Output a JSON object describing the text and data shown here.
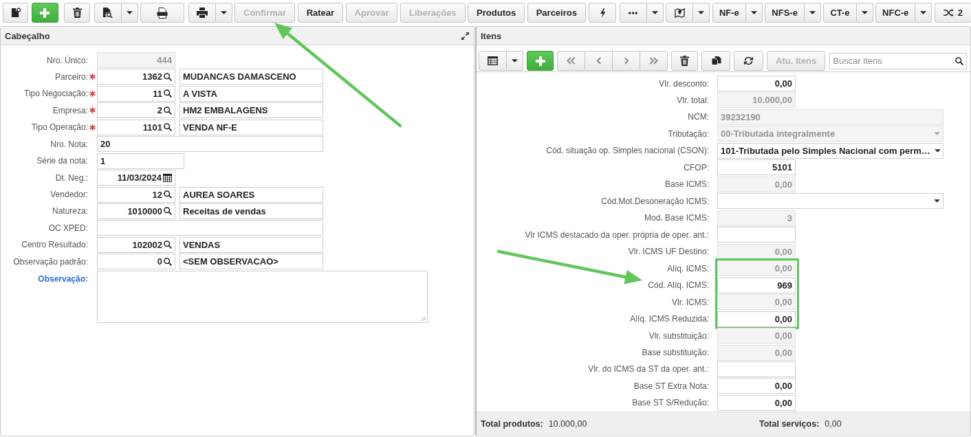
{
  "toolbar": {
    "items": [
      {
        "kind": "icon",
        "disabled": false
      },
      {
        "kind": "primary",
        "disabled": false
      },
      {
        "kind": "icon",
        "disabled": false
      },
      {
        "kind": "split",
        "disabled": false
      },
      {
        "kind": "icon",
        "disabled": false
      },
      {
        "kind": "split",
        "disabled": false
      },
      {
        "kind": "text",
        "label": "Confirmar",
        "disabled": true
      },
      {
        "kind": "text",
        "label": "Ratear",
        "disabled": false
      },
      {
        "kind": "text",
        "label": "Aprovar",
        "disabled": true
      },
      {
        "kind": "text",
        "label": "Liberações",
        "disabled": true
      },
      {
        "kind": "text",
        "label": "Produtos",
        "disabled": false
      },
      {
        "kind": "text",
        "label": "Parceiros",
        "disabled": false
      },
      {
        "kind": "icon",
        "disabled": false
      },
      {
        "kind": "split",
        "disabled": false
      },
      {
        "kind": "split",
        "disabled": false
      },
      {
        "kind": "split",
        "label": "NF-e",
        "disabled": false
      },
      {
        "kind": "split",
        "label": "NFS-e",
        "disabled": false
      },
      {
        "kind": "split",
        "label": "CT-e",
        "disabled": false
      },
      {
        "kind": "split",
        "label": "NFC-e",
        "disabled": false
      },
      {
        "kind": "icon",
        "label": "2",
        "disabled": false
      }
    ]
  },
  "header_panel": {
    "title": "Cabeçalho",
    "fields": [
      {
        "label": "Nro. Único:",
        "required": false,
        "kind": "code",
        "value": "444",
        "disabled": true
      },
      {
        "label": "Parceiro:",
        "required": true,
        "kind": "lookup",
        "value": "1362",
        "description": "MUDANCAS DAMASCENO",
        "disabled": false
      },
      {
        "label": "Tipo Negociação:",
        "required": true,
        "kind": "lookup",
        "value": "11",
        "description": "A VISTA",
        "disabled": false
      },
      {
        "label": "Empresa:",
        "required": true,
        "kind": "lookup",
        "value": "2",
        "description": "HM2 EMBALAGENS",
        "disabled": false
      },
      {
        "label": "Tipo Operação:",
        "required": true,
        "kind": "lookup",
        "value": "1101",
        "description": "VENDA NF-E",
        "disabled": false
      },
      {
        "label": "Nro. Nota:",
        "required": false,
        "kind": "text",
        "value": "20",
        "disabled": false
      },
      {
        "label": "Série da nota:",
        "required": false,
        "kind": "short",
        "value": "1",
        "disabled": false
      },
      {
        "label": "Dt. Neg.:",
        "required": false,
        "kind": "date",
        "value": "11/03/2024",
        "disabled": false
      },
      {
        "label": "Vendedor:",
        "required": false,
        "kind": "lookup",
        "value": "12",
        "description": "AUREA SOARES",
        "disabled": false
      },
      {
        "label": "Natureza:",
        "required": false,
        "kind": "lookup",
        "value": "1010000",
        "description": "Receitas de vendas",
        "disabled": false
      },
      {
        "label": "OC XPED:",
        "required": false,
        "kind": "text",
        "disabled": false
      },
      {
        "label": "Centro Resultado:",
        "required": false,
        "kind": "lookup",
        "value": "102002",
        "description": "VENDAS",
        "disabled": false
      },
      {
        "label": "Observação padrão:",
        "required": false,
        "kind": "lookup",
        "value": "0",
        "description": "<SEM OBSERVACAO>",
        "disabled": false
      },
      {
        "label": "Observação:",
        "required": false,
        "kind": "memo",
        "disabled": false
      }
    ]
  },
  "items_panel": {
    "title": "Itens",
    "toolbar": [
      {
        "kind": "split",
        "disabled": false
      },
      {
        "kind": "primary",
        "disabled": false
      },
      {
        "kind": "nav",
        "disabled": true
      },
      {
        "kind": "nav",
        "disabled": true
      },
      {
        "kind": "nav",
        "disabled": true
      },
      {
        "kind": "nav",
        "disabled": true
      },
      {
        "kind": "icon",
        "disabled": false
      },
      {
        "kind": "icon",
        "disabled": false
      },
      {
        "kind": "icon",
        "disabled": false
      },
      {
        "kind": "text",
        "label": "Atu. Itens",
        "disabled": true
      }
    ],
    "search": {
      "placeholder": "Buscar itens"
    },
    "fields": [
      {
        "label": "Vlr. desconto:",
        "kind": "number",
        "value": "0,00",
        "disabled": false,
        "highlighted": false
      },
      {
        "label": "Vlr. total:",
        "kind": "number",
        "value": "10.000,00",
        "disabled": true,
        "highlighted": false
      },
      {
        "label": "NCM:",
        "kind": "text",
        "value": "39232190",
        "disabled": true,
        "highlighted": false
      },
      {
        "label": "Tributação:",
        "kind": "select",
        "value": "00-Tributada integralmente",
        "disabled": true,
        "highlighted": false
      },
      {
        "label": "Cód. situação op. Simples nacional (CSON):",
        "kind": "select",
        "value": "101-Tributada pelo Simples Nacional com perm…",
        "disabled": false,
        "highlighted": false
      },
      {
        "label": "CFOP:",
        "kind": "number",
        "value": "5101",
        "disabled": false,
        "highlighted": false
      },
      {
        "label": "Base ICMS:",
        "kind": "number",
        "value": "0,00",
        "disabled": true,
        "highlighted": false
      },
      {
        "label": "Cód.Mot.Desoneração ICMS:",
        "kind": "select",
        "disabled": false,
        "highlighted": false
      },
      {
        "label": "Mod. Base ICMS:",
        "kind": "number",
        "value": "3",
        "disabled": true,
        "highlighted": false
      },
      {
        "label": "Vlr ICMS destacado da oper. própria de oper. ant.:",
        "kind": "number",
        "disabled": false,
        "highlighted": false
      },
      {
        "label": "Vlr. ICMS UF Destino:",
        "kind": "number",
        "value": "0,00",
        "disabled": true,
        "highlighted": false
      },
      {
        "label": "Alíq. ICMS:",
        "kind": "number",
        "value": "0,00",
        "disabled": true,
        "highlighted": true
      },
      {
        "label": "Cód. Alíq. ICMS:",
        "kind": "number",
        "value": "969",
        "disabled": false,
        "highlighted": true
      },
      {
        "label": "Vlr. ICMS:",
        "kind": "number",
        "value": "0,00",
        "disabled": true,
        "highlighted": true
      },
      {
        "label": "Alíq. ICMS Reduzida:",
        "kind": "number",
        "value": "0,00",
        "disabled": false,
        "highlighted": true
      },
      {
        "label": "Vlr. substituição:",
        "kind": "number",
        "value": "0,00",
        "disabled": true,
        "highlighted": false
      },
      {
        "label": "Base substituição:",
        "kind": "number",
        "value": "0,00",
        "disabled": true,
        "highlighted": false
      },
      {
        "label": "Vlr. do ICMS da ST da oper. ant.:",
        "kind": "number",
        "disabled": false,
        "highlighted": false
      },
      {
        "label": "Base ST Extra Nota:",
        "kind": "number",
        "value": "0,00",
        "disabled": false,
        "highlighted": false
      },
      {
        "label": "Base ST S/Redução:",
        "kind": "number",
        "value": "0,00",
        "disabled": false,
        "highlighted": false
      }
    ],
    "totals": [
      {
        "label": "Total produtos:",
        "value": "10.000,00"
      },
      {
        "label": "Total serviços:",
        "value": "0,00"
      }
    ]
  },
  "annotations": [
    {
      "kind": "arrow"
    },
    {
      "kind": "arrow"
    }
  ]
}
